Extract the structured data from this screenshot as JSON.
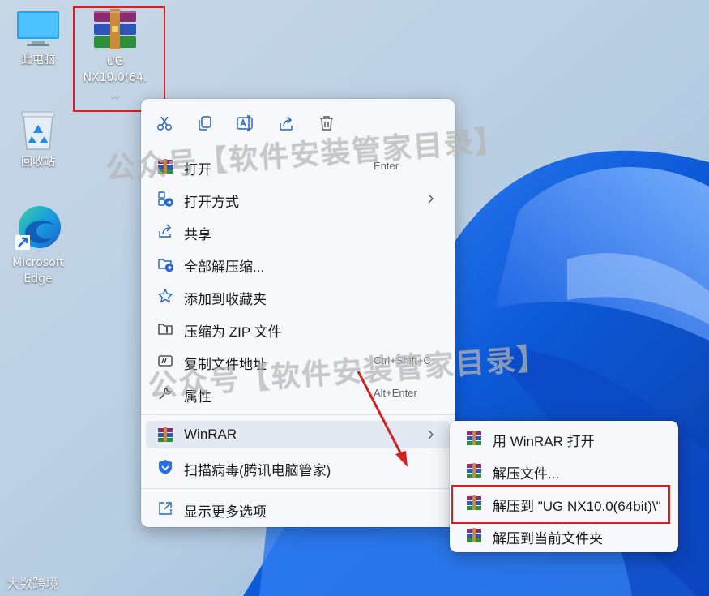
{
  "desktop": {
    "icons": [
      {
        "label": "此电脑",
        "icon": "computer-icon"
      },
      {
        "label": "UG NX10.0(64...",
        "icon": "winrar-archive-icon"
      },
      {
        "label": "回收站",
        "icon": "recycle-bin-icon"
      },
      {
        "label": "Microsoft Edge",
        "icon": "edge-icon"
      }
    ]
  },
  "context_menu": {
    "toolbar": [
      "cut-icon",
      "copy-icon",
      "rename-icon",
      "share-icon",
      "delete-icon"
    ],
    "items": [
      {
        "label": "打开",
        "accel": "Enter",
        "icon": "winrar-icon"
      },
      {
        "label": "打开方式",
        "icon": "open-with-icon",
        "has_submenu": true
      },
      {
        "label": "共享",
        "icon": "share-icon"
      },
      {
        "label": "全部解压缩...",
        "icon": "extract-folder-icon"
      },
      {
        "label": "添加到收藏夹",
        "icon": "star-icon"
      },
      {
        "label": "压缩为 ZIP 文件",
        "icon": "zip-icon"
      },
      {
        "label": "复制文件地址",
        "accel": "Ctrl+Shift+C",
        "icon": "copy-path-icon"
      },
      {
        "label": "属性",
        "accel": "Alt+Enter",
        "icon": "wrench-icon"
      },
      {
        "label": "WinRAR",
        "icon": "winrar-icon",
        "has_submenu": true,
        "highlighted": true
      },
      {
        "label": "扫描病毒(腾讯电脑管家)",
        "icon": "shield-icon"
      },
      {
        "label": "显示更多选项",
        "icon": "more-options-icon"
      }
    ]
  },
  "winrar_submenu": {
    "items": [
      {
        "label": "用 WinRAR 打开"
      },
      {
        "label": "解压文件..."
      },
      {
        "label": "解压到 \"UG NX10.0(64bit)\\\"",
        "highlighted": true
      },
      {
        "label": "解压到当前文件夹"
      }
    ]
  },
  "watermark": {
    "text": "公众号【软件安装管家目录】"
  },
  "corner_logo": {
    "text": "大数跨境"
  },
  "colors": {
    "annotation_red": "#d42020",
    "menu_bg": "#f6f8fb",
    "highlight": "#e3e9f2"
  }
}
